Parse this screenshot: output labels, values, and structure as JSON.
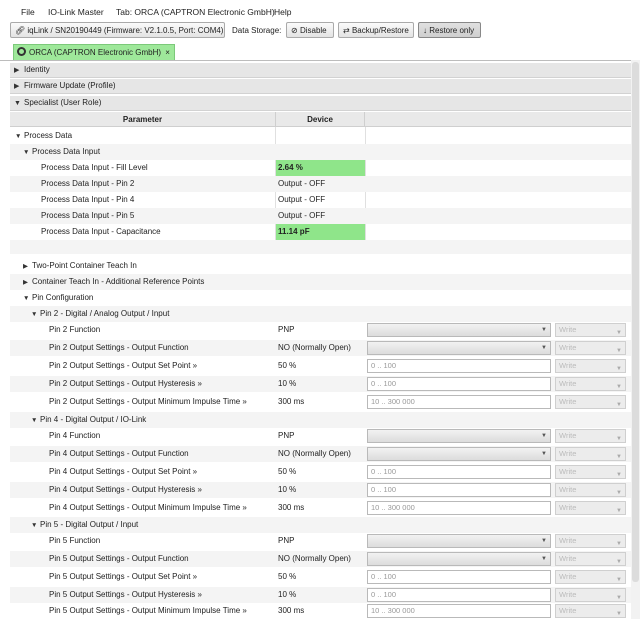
{
  "menu": [
    "File",
    "IO-Link Master",
    "Tab: ORCA (CAPTRON Electronic GmbH)",
    "Help"
  ],
  "toolbar": {
    "device": "iqLink / SN20190449 (Firmware: V2.1.0.5, Port: COM4)",
    "data_storage_label": "Data Storage:",
    "disable": "Disable",
    "backup_restore": "Backup/Restore",
    "restore_only": "Restore only"
  },
  "tab": {
    "label": "ORCA (CAPTRON Electronic GmbH)",
    "close": "×"
  },
  "sections": {
    "identity": "Identity",
    "firmware": "Firmware Update (Profile)",
    "specialist": "Specialist (User Role)"
  },
  "grid": {
    "col_parameter": "Parameter",
    "col_device": "Device"
  },
  "process_data": {
    "title": "Process Data",
    "input_title": "Process Data Input",
    "rows": [
      {
        "label": "Process Data Input - Fill Level",
        "value": "2.64 %"
      },
      {
        "label": "Process Data Input - Pin 2",
        "value": "Output - OFF"
      },
      {
        "label": "Process Data Input - Pin 4",
        "value": "Output - OFF"
      },
      {
        "label": "Process Data Input - Pin 5",
        "value": "Output - OFF"
      },
      {
        "label": "Process Data Input - Capacitance",
        "value": "11.14 pF"
      }
    ]
  },
  "groups": {
    "two_point": "Two-Point Container Teach In",
    "container_teach": "Container Teach In - Additional Reference Points",
    "pin_config": "Pin Configuration"
  },
  "pins": [
    {
      "title": "Pin 2 - Digital / Analog Output / Input",
      "rows": [
        {
          "label": "Pin 2 Function",
          "value": "PNP",
          "placeholder": ""
        },
        {
          "label": "Pin 2 Output Settings - Output Function",
          "value": "NO (Normally Open)",
          "placeholder": ""
        },
        {
          "label": "Pin 2 Output Settings - Output Set Point »",
          "value": "50 %",
          "placeholder": "0 .. 100"
        },
        {
          "label": "Pin 2 Output Settings - Output Hysteresis »",
          "value": "10 %",
          "placeholder": "0 .. 100"
        },
        {
          "label": "Pin 2 Output Settings - Output Minimum Impulse Time »",
          "value": "300 ms",
          "placeholder": "10 .. 300 000"
        }
      ]
    },
    {
      "title": "Pin 4 - Digital Output / IO-Link",
      "rows": [
        {
          "label": "Pin 4 Function",
          "value": "PNP",
          "placeholder": ""
        },
        {
          "label": "Pin 4 Output Settings - Output Function",
          "value": "NO (Normally Open)",
          "placeholder": ""
        },
        {
          "label": "Pin 4 Output Settings - Output Set Point »",
          "value": "50 %",
          "placeholder": "0 .. 100"
        },
        {
          "label": "Pin 4 Output Settings - Output Hysteresis »",
          "value": "10 %",
          "placeholder": "0 .. 100"
        },
        {
          "label": "Pin 4 Output Settings - Output Minimum Impulse Time »",
          "value": "300 ms",
          "placeholder": "10 .. 300 000"
        }
      ]
    },
    {
      "title": "Pin 5 - Digital Output / Input",
      "rows": [
        {
          "label": "Pin 5 Function",
          "value": "PNP",
          "placeholder": ""
        },
        {
          "label": "Pin 5 Output Settings - Output Function",
          "value": "NO (Normally Open)",
          "placeholder": ""
        },
        {
          "label": "Pin 5 Output Settings - Output Set Point »",
          "value": "50 %",
          "placeholder": "0 .. 100"
        },
        {
          "label": "Pin 5 Output Settings - Output Hysteresis »",
          "value": "10 %",
          "placeholder": "0 .. 100"
        },
        {
          "label": "Pin 5 Output Settings - Output Minimum Impulse Time »",
          "value": "300 ms",
          "placeholder": "10 .. 300 000"
        }
      ]
    }
  ],
  "write_label": "Write",
  "colors": {
    "highlight": "#8fe58a",
    "tab": "#9ee89a"
  }
}
